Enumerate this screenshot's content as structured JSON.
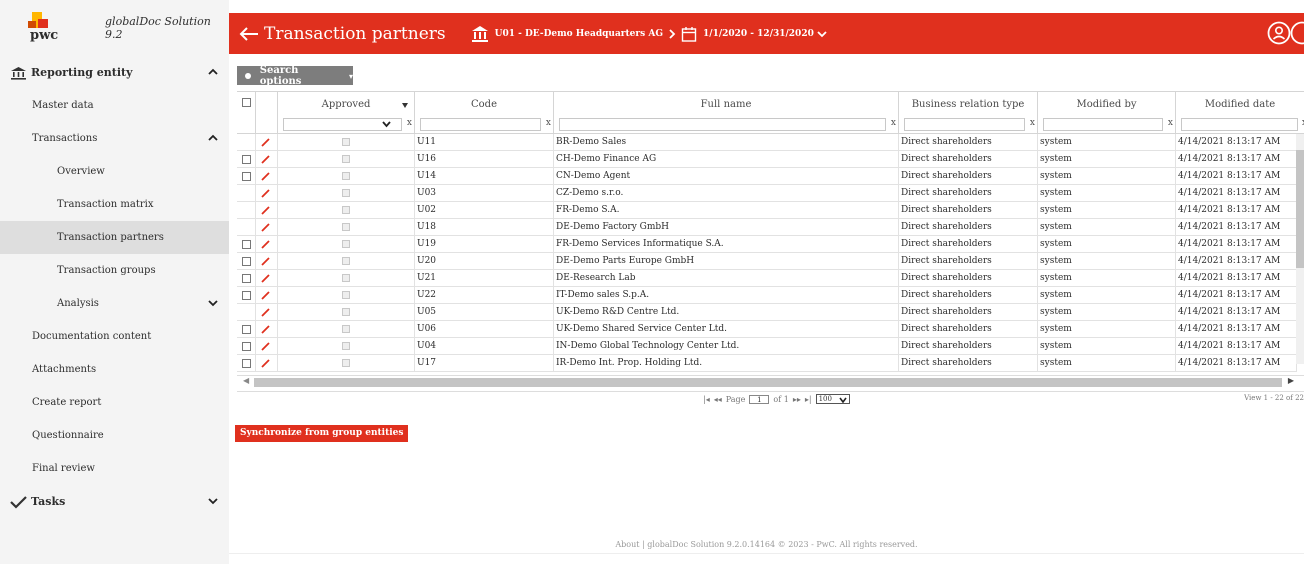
{
  "sidebar": {
    "logo_text": "pwc",
    "product": "globalDoc Solution 9.2",
    "items": [
      {
        "label": "Reporting entity",
        "level": "top",
        "icon": "bank-icon",
        "chevron": "up"
      },
      {
        "label": "Master data",
        "level": "l1"
      },
      {
        "label": "Transactions",
        "level": "l1",
        "chevron": "up"
      },
      {
        "label": "Overview",
        "level": "l2"
      },
      {
        "label": "Transaction matrix",
        "level": "l2"
      },
      {
        "label": "Transaction partners",
        "level": "l2",
        "active": true
      },
      {
        "label": "Transaction groups",
        "level": "l2"
      },
      {
        "label": "Analysis",
        "level": "l2",
        "chevron": "down"
      },
      {
        "label": "Documentation content",
        "level": "l1"
      },
      {
        "label": "Attachments",
        "level": "l1"
      },
      {
        "label": "Create report",
        "level": "l1"
      },
      {
        "label": "Questionnaire",
        "level": "l1"
      },
      {
        "label": "Final review",
        "level": "l1"
      },
      {
        "label": "Tasks",
        "level": "top",
        "icon": "check-icon",
        "chevron": "down"
      }
    ]
  },
  "header": {
    "title": "Transaction partners",
    "entity": "U01 - DE-Demo Headquarters AG",
    "date_range": "1/1/2020 - 12/31/2020"
  },
  "toolbar": {
    "search_options": "Search options"
  },
  "grid": {
    "columns": [
      "Approved",
      "Code",
      "Full name",
      "Business relation type",
      "Modified by",
      "Modified date"
    ],
    "filter_clear": "x",
    "rows": [
      {
        "checkbox": false,
        "code": "U11",
        "name": "BR-Demo Sales",
        "relation": "Direct shareholders",
        "modified_by": "system",
        "modified_date": "4/14/2021 8:13:17 AM"
      },
      {
        "checkbox": true,
        "code": "U16",
        "name": "CH-Demo Finance AG",
        "relation": "Direct shareholders",
        "modified_by": "system",
        "modified_date": "4/14/2021 8:13:17 AM"
      },
      {
        "checkbox": true,
        "code": "U14",
        "name": "CN-Demo Agent",
        "relation": "Direct shareholders",
        "modified_by": "system",
        "modified_date": "4/14/2021 8:13:17 AM"
      },
      {
        "checkbox": false,
        "code": "U03",
        "name": "CZ-Demo s.r.o.",
        "relation": "Direct shareholders",
        "modified_by": "system",
        "modified_date": "4/14/2021 8:13:17 AM"
      },
      {
        "checkbox": false,
        "code": "U02",
        "name": "FR-Demo S.A.",
        "relation": "Direct shareholders",
        "modified_by": "system",
        "modified_date": "4/14/2021 8:13:17 AM"
      },
      {
        "checkbox": false,
        "code": "U18",
        "name": "DE-Demo Factory GmbH",
        "relation": "Direct shareholders",
        "modified_by": "system",
        "modified_date": "4/14/2021 8:13:17 AM"
      },
      {
        "checkbox": true,
        "code": "U19",
        "name": "FR-Demo Services Informatique S.A.",
        "relation": "Direct shareholders",
        "modified_by": "system",
        "modified_date": "4/14/2021 8:13:17 AM"
      },
      {
        "checkbox": true,
        "code": "U20",
        "name": "DE-Demo Parts Europe GmbH",
        "relation": "Direct shareholders",
        "modified_by": "system",
        "modified_date": "4/14/2021 8:13:17 AM"
      },
      {
        "checkbox": true,
        "code": "U21",
        "name": "DE-Research Lab",
        "relation": "Direct shareholders",
        "modified_by": "system",
        "modified_date": "4/14/2021 8:13:17 AM"
      },
      {
        "checkbox": true,
        "code": "U22",
        "name": "IT-Demo sales S.p.A.",
        "relation": "Direct shareholders",
        "modified_by": "system",
        "modified_date": "4/14/2021 8:13:17 AM"
      },
      {
        "checkbox": false,
        "code": "U05",
        "name": "UK-Demo R&D Centre Ltd.",
        "relation": "Direct shareholders",
        "modified_by": "system",
        "modified_date": "4/14/2021 8:13:17 AM"
      },
      {
        "checkbox": true,
        "code": "U06",
        "name": "UK-Demo Shared Service Center Ltd.",
        "relation": "Direct shareholders",
        "modified_by": "system",
        "modified_date": "4/14/2021 8:13:17 AM"
      },
      {
        "checkbox": true,
        "code": "U04",
        "name": "IN-Demo Global Technology Center Ltd.",
        "relation": "Direct shareholders",
        "modified_by": "system",
        "modified_date": "4/14/2021 8:13:17 AM"
      },
      {
        "checkbox": true,
        "code": "U17",
        "name": "IR-Demo Int. Prop. Holding Ltd.",
        "relation": "Direct shareholders",
        "modified_by": "system",
        "modified_date": "4/14/2021 8:13:17 AM"
      }
    ]
  },
  "pager": {
    "page_label": "Page",
    "page_value": "1",
    "of_label": "of 1",
    "page_size": "100",
    "view_info": "View 1 - 22 of 22"
  },
  "actions": {
    "sync": "Synchronize from group entities"
  },
  "footer": {
    "text": "About | globalDoc Solution 9.2.0.14164 © 2023 - PwC. All rights reserved."
  },
  "colors": {
    "brand": "#e0301e",
    "sidebar_bg": "#f4f4f4",
    "active_bg": "#dedede",
    "search_btn": "#7d7d7d"
  }
}
